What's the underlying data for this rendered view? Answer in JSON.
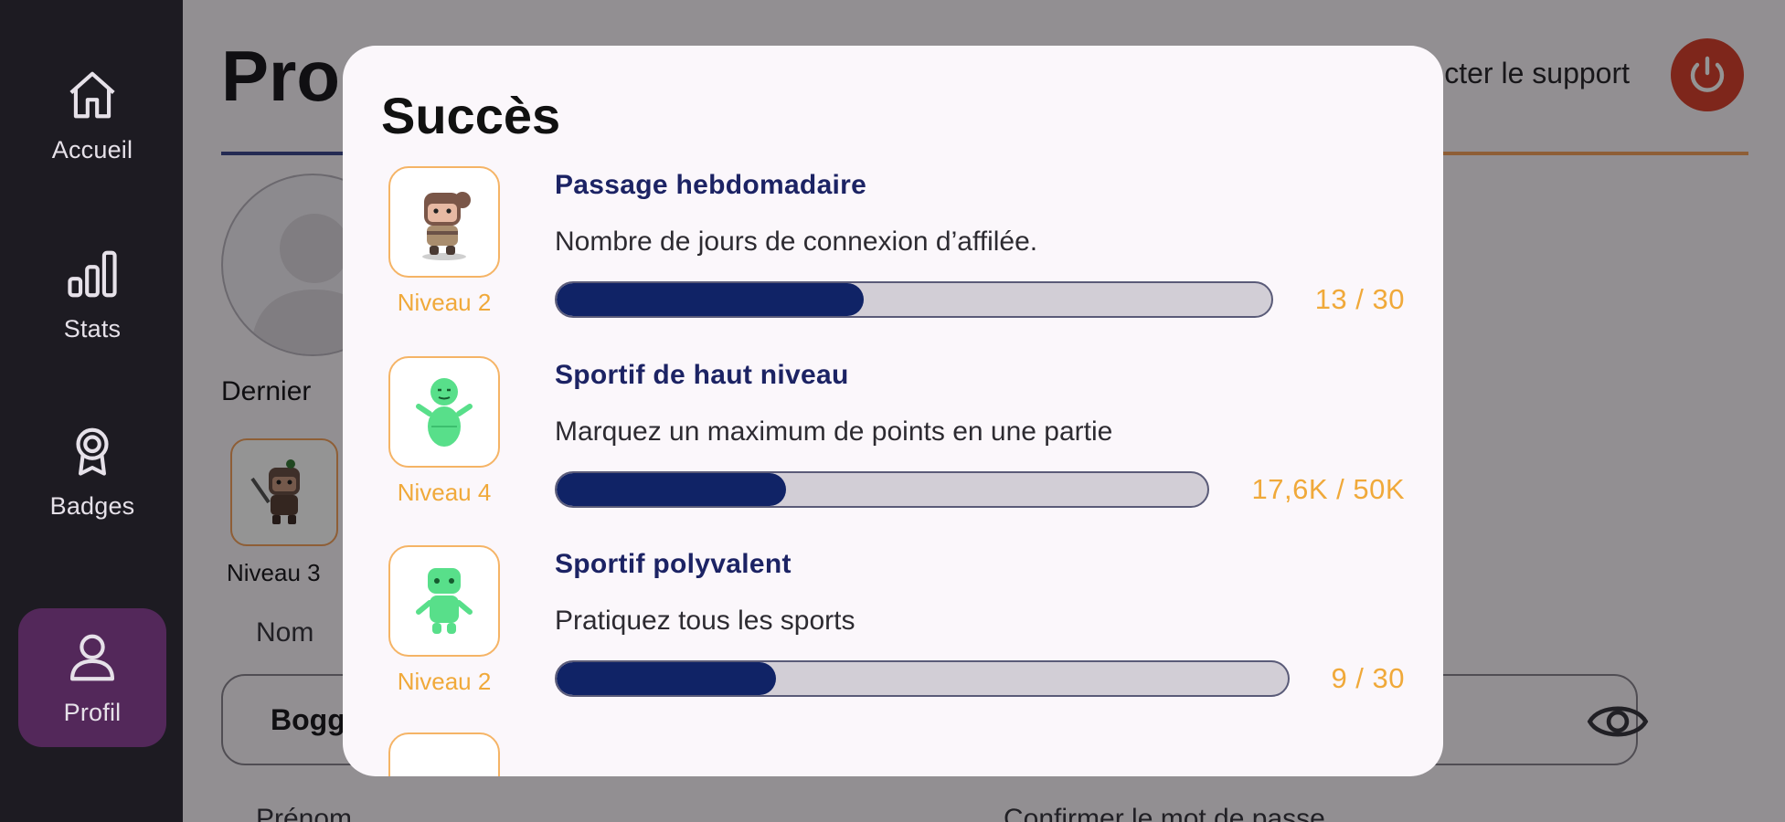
{
  "sidebar": {
    "items": [
      {
        "label": "Accueil",
        "icon": "home-icon"
      },
      {
        "label": "Stats",
        "icon": "stats-icon"
      },
      {
        "label": "Badges",
        "icon": "badge-icon"
      },
      {
        "label": "Profil",
        "icon": "profile-icon",
        "active": true
      }
    ]
  },
  "page": {
    "title": "Pro",
    "support_text": "cter le support",
    "last_label": "Dernier",
    "badge_level": "Niveau 3",
    "name_label": "Nom",
    "name_value": "Bogg",
    "firstname_label": "Prénom",
    "confirm_label": "Confirmer le mot de passe"
  },
  "dialog": {
    "title": "Succès",
    "achievements": [
      {
        "title": "Passage hebdomadaire",
        "description": "Nombre de jours de connexion d’affilée.",
        "level": "Niveau 2",
        "progress_text": "13 / 30",
        "progress": 0.43,
        "icon": "hero-character-icon"
      },
      {
        "title": "Sportif de haut niveau",
        "description": "Marquez un maximum de points en une partie",
        "level": "Niveau 4",
        "progress_text": "17,6K / 50K",
        "progress": 0.352,
        "icon": "green-robot-icon"
      },
      {
        "title": "Sportif polyvalent",
        "description": "Pratiquez tous les sports",
        "level": "Niveau 2",
        "progress_text": "9 / 30",
        "progress": 0.3,
        "icon": "green-android-icon"
      }
    ]
  },
  "colors": {
    "accent_orange": "#f0a93a",
    "progress_fill": "#102366",
    "active_nav": "#53285a",
    "logout": "#d9432f"
  }
}
